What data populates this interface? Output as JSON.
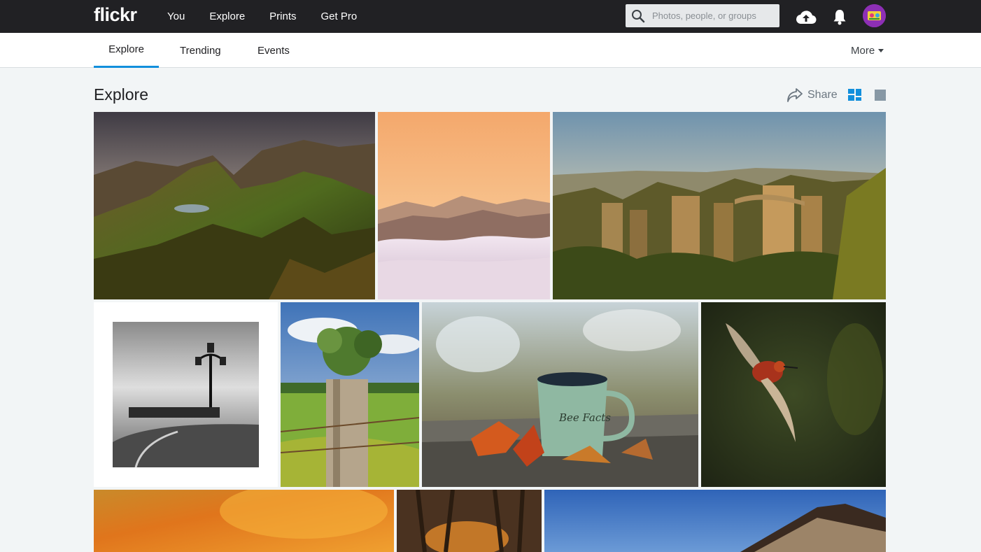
{
  "header": {
    "logo": "flickr",
    "nav": [
      "You",
      "Explore",
      "Prints",
      "Get Pro"
    ],
    "search_placeholder": "Photos, people, or groups",
    "icons": [
      "upload-cloud-icon",
      "bell-icon",
      "avatar"
    ]
  },
  "subnav": {
    "tabs": [
      "Explore",
      "Trending",
      "Events"
    ],
    "active_tab": "Explore",
    "more_label": "More"
  },
  "page": {
    "title": "Explore",
    "share_label": "Share",
    "view_modes": [
      "grid-view",
      "single-view"
    ],
    "active_view": "grid-view"
  },
  "colors": {
    "topbar": "#212124",
    "accent": "#128fdc",
    "background": "#f2f5f6"
  },
  "photos": [
    {
      "row": 1,
      "subject": "mountain-landscape"
    },
    {
      "row": 1,
      "subject": "sunset-sea-of-clouds"
    },
    {
      "row": 1,
      "subject": "rock-formations-bridge"
    },
    {
      "row": 2,
      "subject": "black-white-lamppost-pier"
    },
    {
      "row": 2,
      "subject": "tree-stump-plant"
    },
    {
      "row": 2,
      "subject": "enamel-mug-autumn-leaves"
    },
    {
      "row": 2,
      "subject": "hummingbird-flight"
    },
    {
      "row": 3,
      "subject": "orange-bokeh"
    },
    {
      "row": 3,
      "subject": "trees-sunset"
    },
    {
      "row": 3,
      "subject": "building-blue-sky"
    }
  ],
  "mug_text": "Bee Facts"
}
